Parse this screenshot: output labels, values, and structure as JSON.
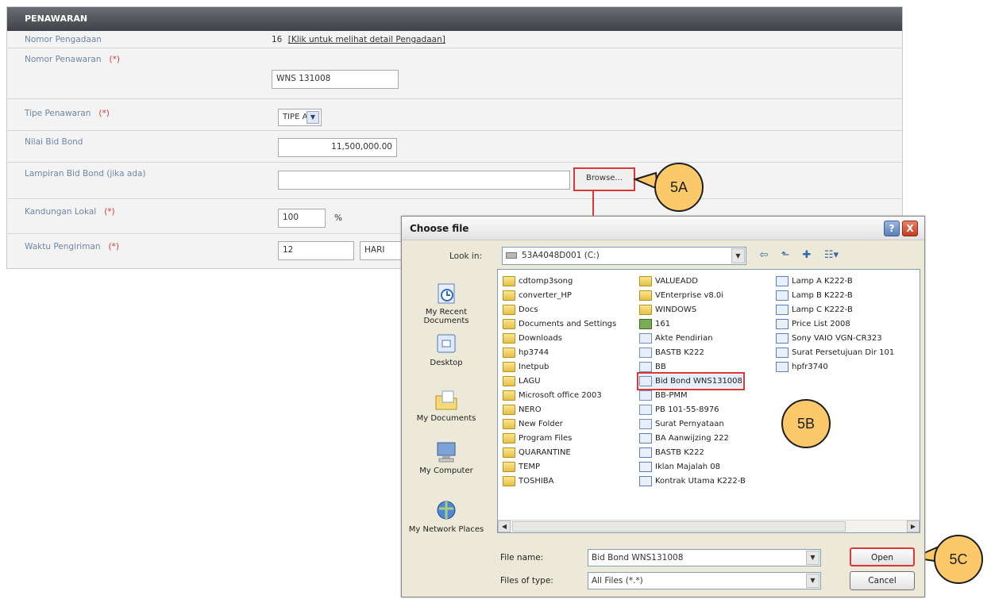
{
  "form": {
    "header": "PENAWARAN",
    "rows": {
      "nomor_pengadaan": {
        "label": "Nomor Pengadaan",
        "number": "16",
        "link": "[Klik untuk melihat detail Pengadaan]"
      },
      "nomor_penawaran": {
        "label": "Nomor Penawaran",
        "required": "(*)",
        "value": "WNS 131008"
      },
      "tipe_penawaran": {
        "label": "Tipe Penawaran",
        "required": "(*)",
        "value": "TIPE A"
      },
      "nilai_bid_bond": {
        "label": "Nilai Bid Bond",
        "value": "11,500,000.00"
      },
      "lampiran_bid_bond": {
        "label": "Lampiran Bid Bond (jika ada)",
        "value": "",
        "browse": "Browse..."
      },
      "kandungan_lokal": {
        "label": "Kandungan Lokal",
        "required": "(*)",
        "value": "100",
        "unit": "%"
      },
      "waktu_pengiriman": {
        "label": "Waktu Pengiriman",
        "required": "(*)",
        "value": "12",
        "unit": "HARI"
      }
    }
  },
  "callouts": {
    "a": "5A",
    "b": "5B",
    "c": "5C"
  },
  "dialog": {
    "title": "Choose file",
    "help": "?",
    "close": "X",
    "look_in_label": "Look in:",
    "look_in_value": "53A4048D001 (C:)",
    "places": [
      "My Recent Documents",
      "Desktop",
      "My Documents",
      "My Computer",
      "My Network Places"
    ],
    "files_col1": [
      "cdtomp3song",
      "converter_HP",
      "Docs",
      "Documents and Settings",
      "Downloads",
      "hp3744",
      "Inetpub",
      "LAGU",
      "Microsoft office 2003",
      "NERO",
      "New Folder",
      "Program Files",
      "QUARANTINE",
      "TEMP",
      "TOSHIBA"
    ],
    "files_col2": [
      "VALUEADD",
      "VEnterprise v8.0i",
      "WINDOWS",
      "161",
      "Akte Pendirian",
      "BASTB K222",
      "BB",
      "Bid Bond WNS131008",
      "BB-PMM",
      "PB 101-55-8976",
      "Surat Pernyataan",
      "BA Aanwijzing 222",
      "BASTB K222",
      "Iklan Majalah 08",
      "Kontrak Utama K222-B"
    ],
    "files_col3": [
      "Lamp A K222-B",
      "Lamp B K222-B",
      "Lamp C K222-B",
      "Price List 2008",
      "Sony VAIO VGN-CR323",
      "Surat Persetujuan Dir 101",
      "hpfr3740"
    ],
    "file_name_label": "File name:",
    "file_name_value": "Bid Bond WNS131008",
    "files_of_type_label": "Files of type:",
    "files_of_type_value": "All Files (*.*)",
    "open": "Open",
    "cancel": "Cancel"
  },
  "colors": {
    "highlight": "#d9373a",
    "callout_fill": "#fbc96a",
    "label_blue": "#6f86a5"
  }
}
